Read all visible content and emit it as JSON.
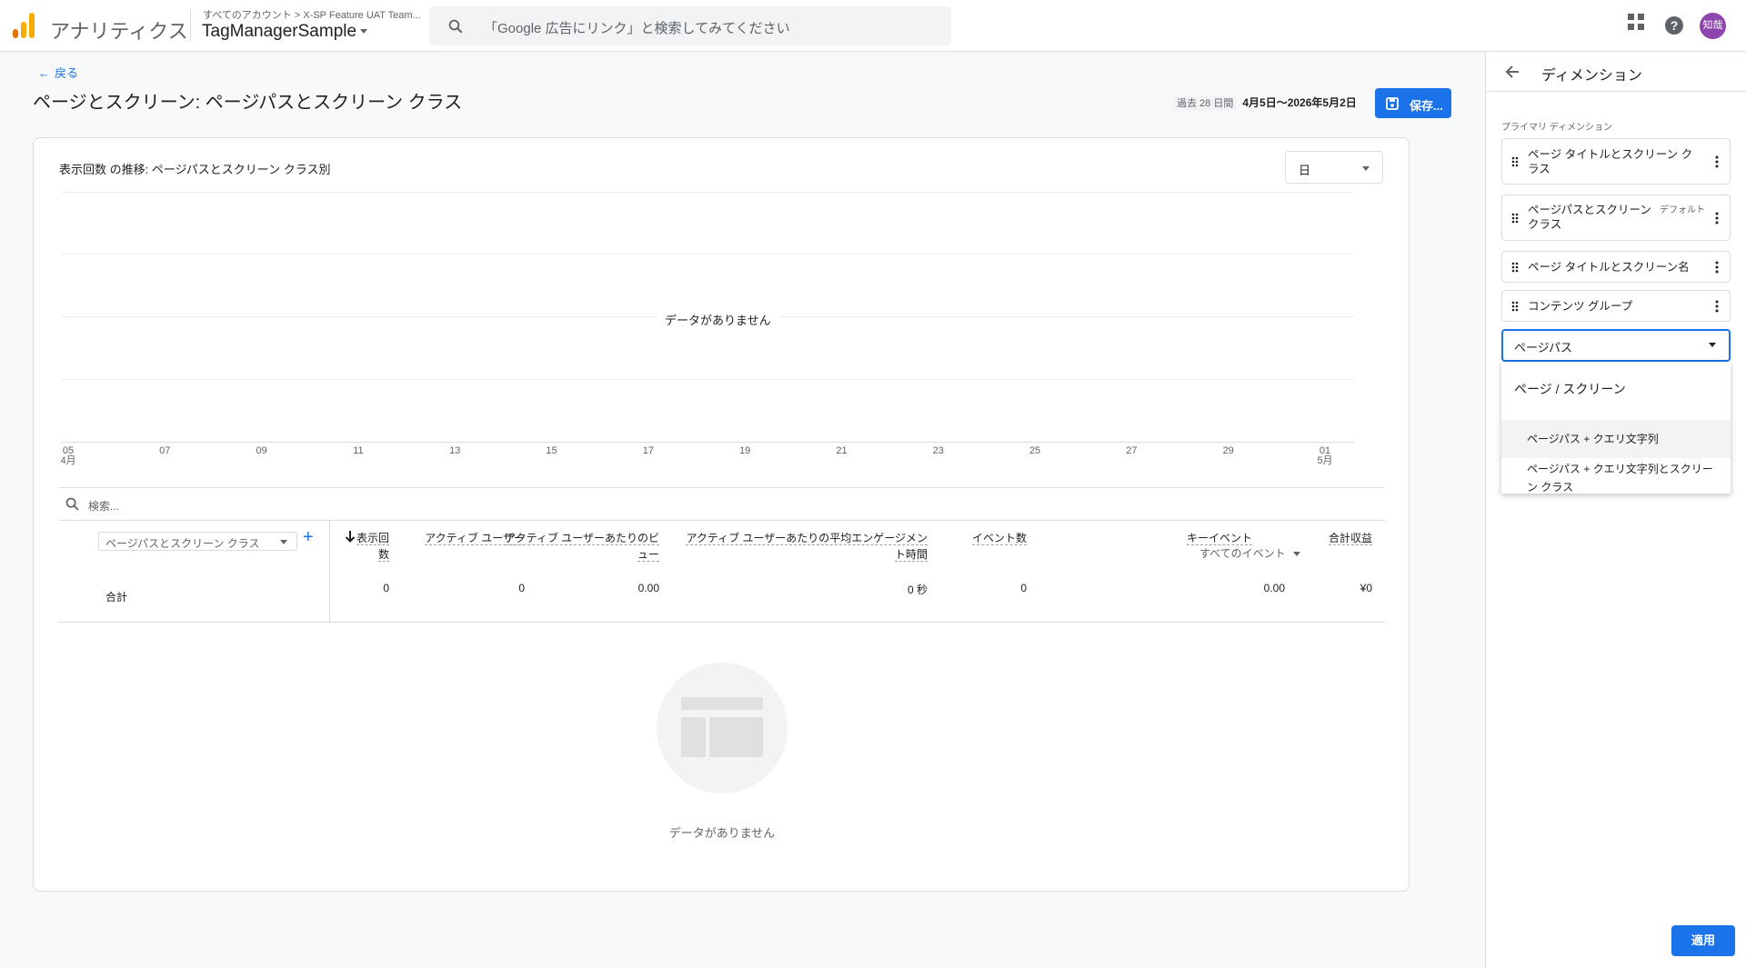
{
  "header": {
    "app_name": "アナリティクス",
    "breadcrumb": "すべてのアカウント > X-SP Feature UAT Team...",
    "property_name": "TagManagerSample",
    "search_placeholder": "「Google 広告にリンク」と検索してみてください",
    "avatar_text": "知哉"
  },
  "report": {
    "back_label": "戻る",
    "title": "ページとスクリーン: ページパスとスクリーン クラス",
    "date_chip": "過去 28 日間",
    "date_value": "4月5日～2026年5月2日",
    "save_label": "保存..."
  },
  "chart": {
    "title": "表示回数 の推移: ページパスとスクリーン クラス別",
    "granularity": "日",
    "no_data": "データがありません"
  },
  "chart_data": {
    "type": "line",
    "title": "表示回数 の推移: ページパスとスクリーン クラス別",
    "x": [
      "05\n4月",
      "07",
      "09",
      "11",
      "13",
      "15",
      "17",
      "19",
      "21",
      "23",
      "25",
      "27",
      "29",
      "01\n5月"
    ],
    "series": [],
    "grid": true,
    "annotation": "データがありません"
  },
  "table": {
    "search_placeholder": "検索...",
    "dimension_select": "ページパスとスクリーン クラス",
    "add_symbol": "+",
    "total_label": "合計",
    "metrics": [
      {
        "label": "表示回数",
        "value": "0"
      },
      {
        "label": "アクティブ ユーザー",
        "value": "0"
      },
      {
        "label": "アクティブ ユーザーあたりのビュー",
        "value": "0.00"
      },
      {
        "label": "アクティブ ユーザーあたりの平均エンゲージメント時間",
        "value": "0 秒"
      },
      {
        "label": "イベント数",
        "value": "0"
      },
      {
        "label": "キーイベント",
        "sub": "すべてのイベント",
        "value": "0.00"
      },
      {
        "label": "合計収益",
        "value": "¥0"
      }
    ],
    "empty_label": "データがありません"
  },
  "panel": {
    "title": "ディメンション",
    "section_label": "プライマリ ディメンション",
    "items": [
      {
        "label": "ページ タイトルとスクリーン クラス"
      },
      {
        "label": "ページパスとスクリーン クラス",
        "badge": "デフォルト"
      },
      {
        "label": "ページ タイトルとスクリーン名"
      },
      {
        "label": "コンテンツ グループ"
      }
    ],
    "combo_value": "ページパス",
    "dropdown_group": "ページ / スクリーン",
    "dropdown_options": [
      "ページパス + クエリ文字列",
      "ページパス + クエリ文字列とスクリーン クラス"
    ],
    "apply_label": "適用"
  },
  "colors": {
    "accent": "#1a73e8",
    "logo_orange": "#f9ab00",
    "logo_dark_orange": "#e37400",
    "avatar": "#8e44ad"
  }
}
